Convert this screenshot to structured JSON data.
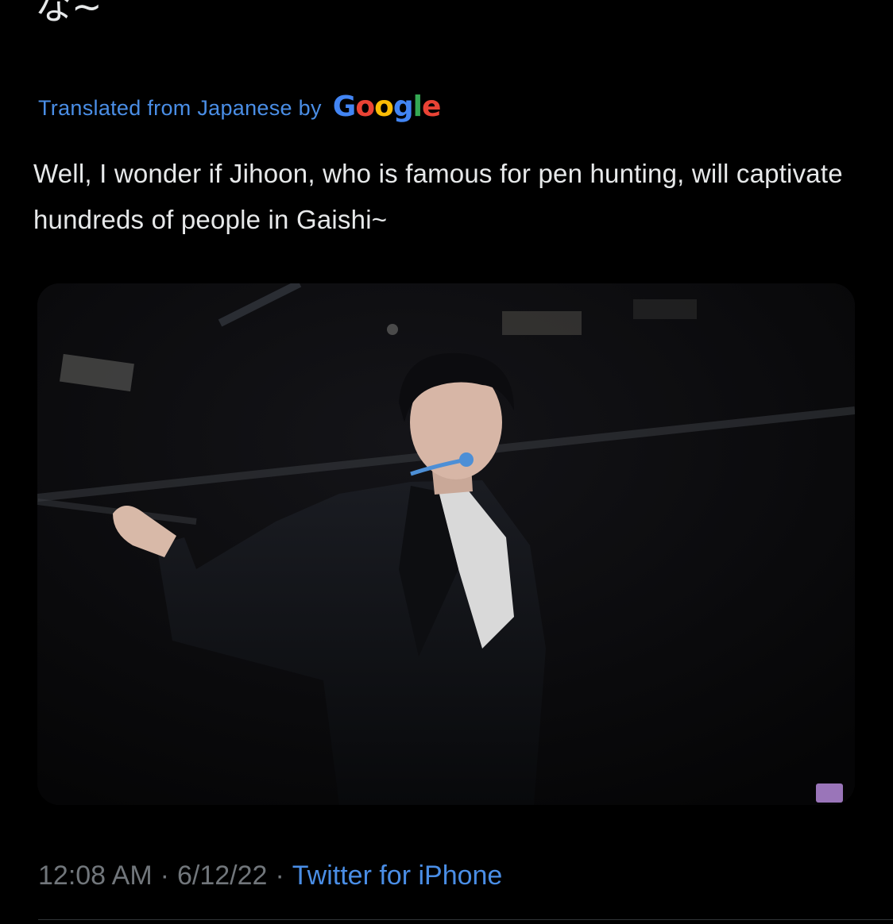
{
  "tweet": {
    "original_text_visible": "な~",
    "translation": {
      "label": "Translated from Japanese by",
      "provider_letters": [
        {
          "char": "G",
          "color": "#4285F4"
        },
        {
          "char": "o",
          "color": "#EA4335"
        },
        {
          "char": "o",
          "color": "#FBBC05"
        },
        {
          "char": "g",
          "color": "#4285F4"
        },
        {
          "char": "l",
          "color": "#34A853"
        },
        {
          "char": "e",
          "color": "#EA4335"
        }
      ],
      "text": "Well, I wonder if Jihoon, who is famous for pen hunting, will captivate hundreds of people in Gaishi~"
    },
    "media": {
      "type": "photo"
    },
    "footer": {
      "time": "12:08 AM",
      "date": "6/12/22",
      "separator": "·",
      "source": "Twitter for iPhone"
    }
  },
  "colors": {
    "background": "#000000",
    "text_primary": "#e7e9ea",
    "text_secondary": "#71767b",
    "link": "#4a8ee6"
  }
}
